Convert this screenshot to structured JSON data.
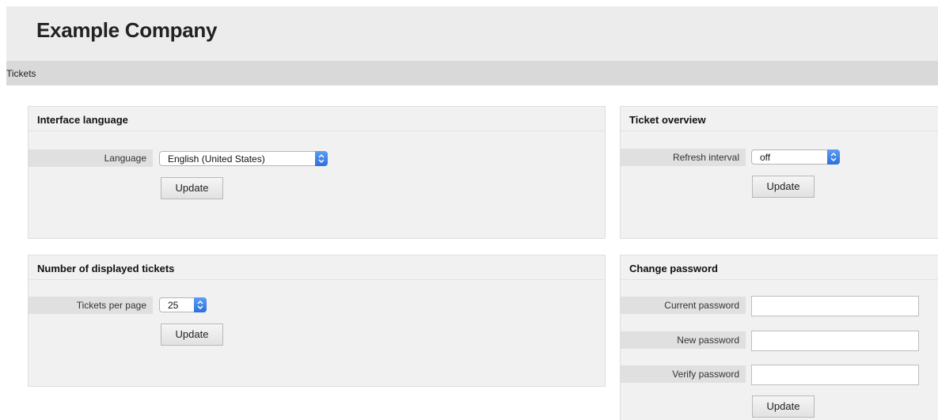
{
  "header": {
    "company_name": "Example Company"
  },
  "nav": {
    "items": [
      {
        "label": "Tickets"
      }
    ]
  },
  "panels": {
    "interface_language": {
      "title": "Interface language",
      "field_label": "Language",
      "selected_value": "English (United States)",
      "button_label": "Update"
    },
    "ticket_overview": {
      "title": "Ticket overview",
      "field_label": "Refresh interval",
      "selected_value": "off",
      "button_label": "Update"
    },
    "displayed_tickets": {
      "title": "Number of displayed tickets",
      "field_label": "Tickets per page",
      "selected_value": "25",
      "button_label": "Update"
    },
    "change_password": {
      "title": "Change password",
      "current_label": "Current password",
      "new_label": "New password",
      "verify_label": "Verify password",
      "button_label": "Update"
    }
  },
  "icons": {
    "select_arrow": "chevron-up-down-icon"
  },
  "colors": {
    "select_accent": "#3b82ea"
  }
}
